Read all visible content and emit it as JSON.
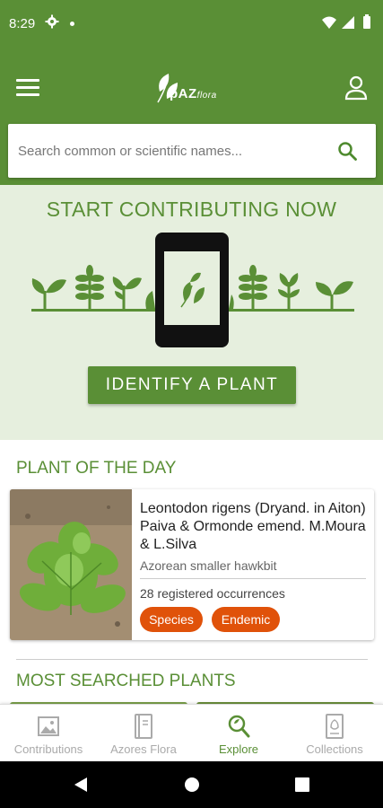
{
  "status_bar": {
    "time": "8:29"
  },
  "app_bar": {
    "logo_text": "pAZ",
    "logo_text_suffix": "flora",
    "search_placeholder": "Search common or scientific names..."
  },
  "hero": {
    "title": "START CONTRIBUTING NOW",
    "button_label": "IDENTIFY A PLANT"
  },
  "plant_of_the_day": {
    "section_title": "PLANT OF THE DAY",
    "scientific_name": "Leontodon rigens (Dryand. in Aiton) Paiva & Ormonde emend. M.Moura & L.Silva",
    "common_name": "Azorean smaller hawkbit",
    "occurrences": "28 registered occurrences",
    "tags": [
      "Species",
      "Endemic"
    ]
  },
  "most_searched": {
    "section_title": "MOST SEARCHED PLANTS"
  },
  "bottom_nav": {
    "items": [
      {
        "label": "Contributions",
        "icon": "image-icon",
        "active": false
      },
      {
        "label": "Azores Flora",
        "icon": "book-icon",
        "active": false
      },
      {
        "label": "Explore",
        "icon": "search-icon",
        "active": true
      },
      {
        "label": "Collections",
        "icon": "collection-icon",
        "active": false
      }
    ]
  },
  "colors": {
    "primary": "#5a8f36",
    "hero_background": "#e6efde",
    "tag": "#e0520a",
    "inactive_nav": "#aaaaaa"
  }
}
